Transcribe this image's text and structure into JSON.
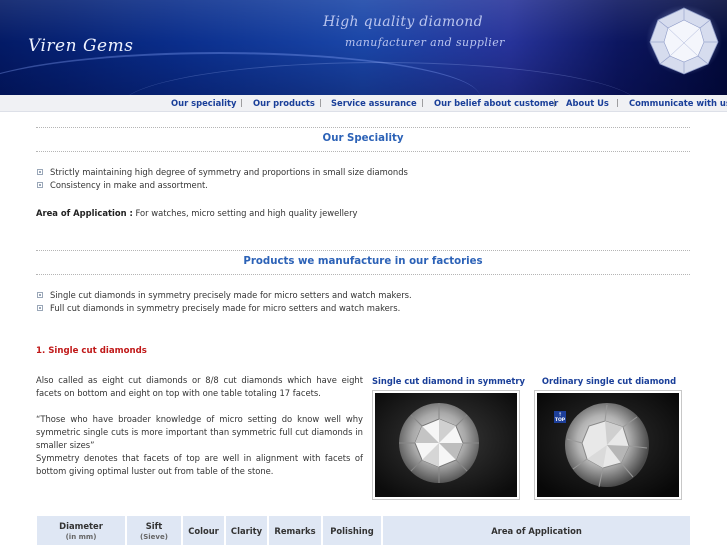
{
  "header": {
    "logo": "Viren Gems",
    "tagline_line1": "High quality diamond",
    "tagline_line2": "manufacturer and supplier",
    "accent": "#0a2e8c"
  },
  "nav": {
    "items": [
      {
        "label": "Our speciality"
      },
      {
        "label": "Our products"
      },
      {
        "label": "Service assurance"
      },
      {
        "label": "Our belief about customer"
      },
      {
        "label": "About Us"
      },
      {
        "label": "Communicate with us"
      }
    ],
    "separator": "|",
    "color": "#1a3f99"
  },
  "speciality": {
    "title": "Our Speciality",
    "bullets": [
      "Strictly maintaining high degree of symmetry and proportions in small size diamonds",
      "Consistency in make and assortment."
    ],
    "area_label": "Area of Application :",
    "area_text": "For watches, micro setting and high quality jewellery"
  },
  "products": {
    "title": "Products we manufacture in our factories",
    "bullets": [
      "Single cut diamonds in symmetry precisely made for micro setters and watch makers.",
      "Full cut diamonds in symmetry precisely made for micro setters and watch makers."
    ]
  },
  "single_cut": {
    "heading": "1. Single cut diamonds",
    "para1": "Also called as eight cut diamonds or 8/8 cut diamonds which have eight facets on bottom and eight on top with one table totaling 17 facets.",
    "para2": "“Those who have broader knowledge of micro setting do know well why symmetric single cuts is more important than symmetric full cut diamonds in smaller sizes”",
    "para3": "Symmetry denotes that facets of top are well in alignment with facets of bottom giving optimal luster out from table of the stone.",
    "image1_caption": "Single cut diamond in symmetry",
    "image2_caption": "Ordinary single cut diamond",
    "image2_badge": "TOP"
  },
  "table": {
    "headers": [
      {
        "label": "Diameter",
        "sub": "(in mm)"
      },
      {
        "label": "Sift",
        "sub": "(Sieve)"
      },
      {
        "label": "Colour",
        "sub": ""
      },
      {
        "label": "Clarity",
        "sub": ""
      },
      {
        "label": "Remarks",
        "sub": ""
      },
      {
        "label": "Polishing",
        "sub": ""
      },
      {
        "label": "Area of Application",
        "sub": ""
      }
    ]
  }
}
